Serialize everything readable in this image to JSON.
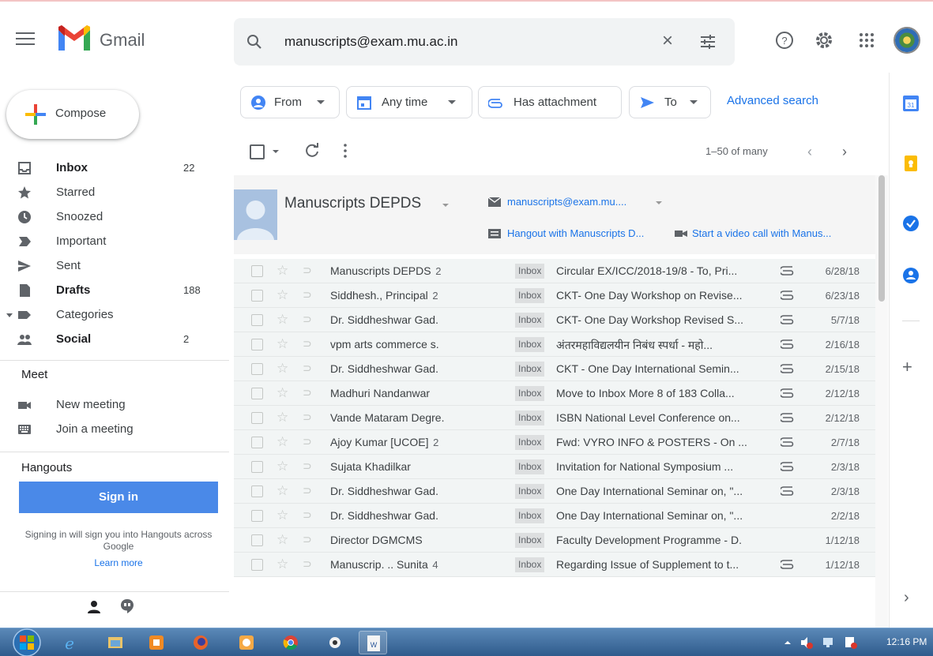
{
  "app": {
    "name": "Gmail"
  },
  "search": {
    "value": "manuscripts@exam.mu.ac.in",
    "clear_symbol": "×"
  },
  "compose": {
    "label": "Compose"
  },
  "nav": [
    {
      "label": "Inbox",
      "count": "22",
      "bold": true,
      "icon": "inbox-icon"
    },
    {
      "label": "Starred",
      "count": "",
      "bold": false,
      "icon": "star-icon"
    },
    {
      "label": "Snoozed",
      "count": "",
      "bold": false,
      "icon": "clock-icon"
    },
    {
      "label": "Important",
      "count": "",
      "bold": false,
      "icon": "important-icon"
    },
    {
      "label": "Sent",
      "count": "",
      "bold": false,
      "icon": "send-icon"
    },
    {
      "label": "Drafts",
      "count": "188",
      "bold": true,
      "icon": "draft-icon"
    },
    {
      "label": "Categories",
      "count": "",
      "bold": false,
      "icon": "label-icon"
    },
    {
      "label": "Social",
      "count": "2",
      "bold": true,
      "icon": "people-icon"
    }
  ],
  "meet": {
    "title": "Meet",
    "items": [
      {
        "label": "New meeting",
        "icon": "video-camera-icon"
      },
      {
        "label": "Join a meeting",
        "icon": "keyboard-icon"
      }
    ]
  },
  "hangouts": {
    "title": "Hangouts",
    "sign_in": "Sign in",
    "note": "Signing in will sign you into Hangouts across Google",
    "learn_more": "Learn more"
  },
  "filters": {
    "from": "From",
    "any_time": "Any time",
    "has_attachment": "Has attachment",
    "to": "To",
    "advanced": "Advanced search"
  },
  "toolbar": {
    "pager": "1–50 of many",
    "prev": "‹",
    "next": "›"
  },
  "contact": {
    "name": "Manuscripts DEPDS",
    "email": "manuscripts@exam.mu....",
    "hangout": "Hangout with Manuscripts D...",
    "video": "Start a video call with Manus..."
  },
  "emails": [
    {
      "from": "Manuscripts DEPDS",
      "n": "2",
      "label": "Inbox",
      "subject": "Circular EX/ICC/2018-19/8 - To, Pri...",
      "attach": true,
      "date": "6/28/18"
    },
    {
      "from": "Siddhesh., Principal",
      "n": "2",
      "label": "Inbox",
      "subject": "CKT- One Day Workshop on Revise...",
      "attach": true,
      "date": "6/23/18"
    },
    {
      "from": "Dr. Siddheshwar Gad.",
      "n": "",
      "label": "Inbox",
      "subject": "CKT- One Day Workshop Revised S...",
      "attach": true,
      "date": "5/7/18"
    },
    {
      "from": "vpm arts commerce s.",
      "n": "",
      "label": "Inbox",
      "subject": "अंतरमहाविद्यलयीन निबंध स्पर्धा - महो...",
      "attach": true,
      "date": "2/16/18"
    },
    {
      "from": "Dr. Siddheshwar Gad.",
      "n": "",
      "label": "Inbox",
      "subject": "CKT - One Day International Semin...",
      "attach": true,
      "date": "2/15/18"
    },
    {
      "from": "Madhuri Nandanwar",
      "n": "",
      "label": "Inbox",
      "subject": "Move to Inbox More 8 of 183 Colla...",
      "attach": true,
      "date": "2/12/18"
    },
    {
      "from": "Vande Mataram Degre.",
      "n": "",
      "label": "Inbox",
      "subject": "ISBN National Level Conference on...",
      "attach": true,
      "date": "2/12/18"
    },
    {
      "from": "Ajoy Kumar [UCOE]",
      "n": "2",
      "label": "Inbox",
      "subject": "Fwd: VYRO INFO & POSTERS - On ...",
      "attach": true,
      "date": "2/7/18"
    },
    {
      "from": "Sujata Khadilkar",
      "n": "",
      "label": "Inbox",
      "subject": "Invitation for National Symposium ...",
      "attach": true,
      "date": "2/3/18"
    },
    {
      "from": "Dr. Siddheshwar Gad.",
      "n": "",
      "label": "Inbox",
      "subject": "One Day International Seminar on, \"...",
      "attach": true,
      "date": "2/3/18"
    },
    {
      "from": "Dr. Siddheshwar Gad.",
      "n": "",
      "label": "Inbox",
      "subject": "One Day International Seminar on, \"...",
      "attach": false,
      "date": "2/2/18"
    },
    {
      "from": "Director DGMCMS",
      "n": "",
      "label": "Inbox",
      "subject": "Faculty Development Programme - D.",
      "attach": false,
      "date": "1/12/18"
    },
    {
      "from": "Manuscrip. .. Sunita",
      "n": "4",
      "label": "Inbox",
      "subject": "Regarding Issue of Supplement to t...",
      "attach": true,
      "date": "1/12/18"
    }
  ],
  "taskbar": {
    "clock": "12:16 PM"
  },
  "colors": {
    "accent_blue": "#1a73e8",
    "signin_blue": "#4a89e8"
  }
}
